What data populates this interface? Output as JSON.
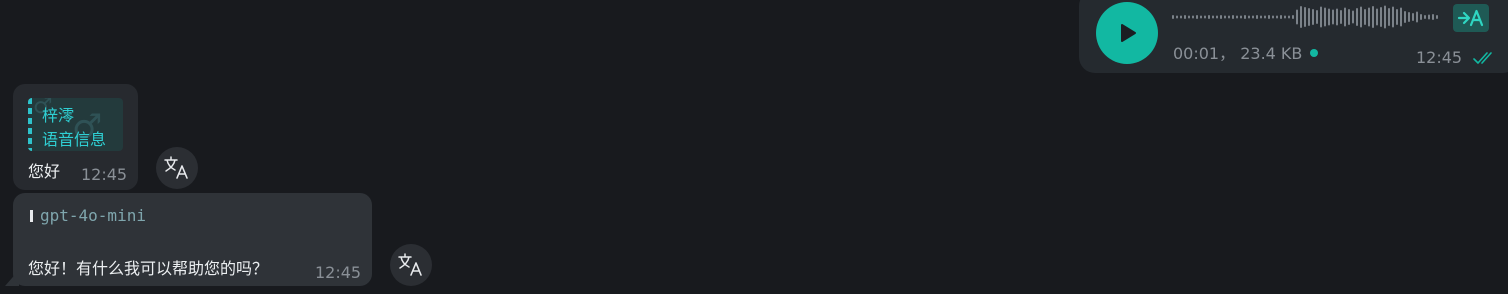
{
  "colors": {
    "background": "#181a1e",
    "accent": "#12b8a2",
    "bubble_outgoing": "#252a2f",
    "bubble_incoming": "#2f3338",
    "quote_name": "#2fd0d4"
  },
  "voice_message": {
    "duration": "00:01",
    "separator": "，",
    "size": "23.4 KB",
    "time": "12:45",
    "play_icon": "play-icon",
    "transcribe_icon": "transcribe-icon",
    "status_icon": "double-check-icon"
  },
  "message_1": {
    "quote": {
      "sender": "梓澪",
      "text": "语音信息",
      "icon": "male-sign-icon"
    },
    "text": "您好",
    "time": "12:45",
    "translate_icon": "translate-icon"
  },
  "message_2": {
    "sender": "gpt-4o-mini",
    "text": "您好！有什么我可以帮助您的吗？",
    "time": "12:45",
    "translate_icon": "translate-icon"
  }
}
